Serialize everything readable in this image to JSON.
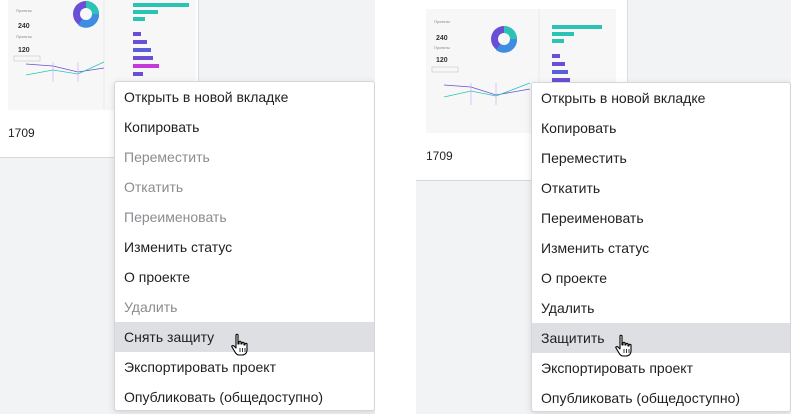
{
  "colors": {
    "panel_bg": "#f2f3f5",
    "menu_text": "#1f1f1f",
    "menu_disabled_text": "#8a8c90",
    "menu_highlight_bg": "#dedfe2",
    "chart_teal": "#2bc4b4",
    "chart_purple": "#6a4fd6",
    "chart_magenta": "#c43ad9"
  },
  "left": {
    "card": {
      "title": "1709",
      "thumb": {
        "kpi1_label": "Проекты",
        "kpi1_value": "240",
        "kpi2_label": "Проекты",
        "kpi2_value": "120"
      }
    },
    "menu": {
      "items": [
        {
          "label": "Открыть в новой вкладке",
          "disabled": false
        },
        {
          "label": "Копировать",
          "disabled": false
        },
        {
          "label": "Переместить",
          "disabled": true
        },
        {
          "label": "Откатить",
          "disabled": true
        },
        {
          "label": "Переименовать",
          "disabled": true
        },
        {
          "label": "Изменить статус",
          "disabled": false
        },
        {
          "label": "О проекте",
          "disabled": false
        },
        {
          "label": "Удалить",
          "disabled": true
        },
        {
          "label": "Снять защиту",
          "disabled": false,
          "highlighted": true
        },
        {
          "label": "Экспортировать проект",
          "disabled": false
        },
        {
          "label": "Опубликовать (общедоступно)",
          "disabled": false
        }
      ]
    }
  },
  "right": {
    "card": {
      "title": "1709",
      "thumb": {
        "kpi1_label": "Проекты",
        "kpi1_value": "240",
        "kpi2_label": "Проекты",
        "kpi2_value": "120"
      }
    },
    "menu": {
      "items": [
        {
          "label": "Открыть в новой вкладке",
          "disabled": false
        },
        {
          "label": "Копировать",
          "disabled": false
        },
        {
          "label": "Переместить",
          "disabled": false
        },
        {
          "label": "Откатить",
          "disabled": false
        },
        {
          "label": "Переименовать",
          "disabled": false
        },
        {
          "label": "Изменить статус",
          "disabled": false
        },
        {
          "label": "О проекте",
          "disabled": false
        },
        {
          "label": "Удалить",
          "disabled": false
        },
        {
          "label": "Защитить",
          "disabled": false,
          "highlighted": true
        },
        {
          "label": "Экспортировать проект",
          "disabled": false
        },
        {
          "label": "Опубликовать (общедоступно)",
          "disabled": false
        }
      ]
    }
  },
  "cursor_icon": "hand-pointer-icon"
}
